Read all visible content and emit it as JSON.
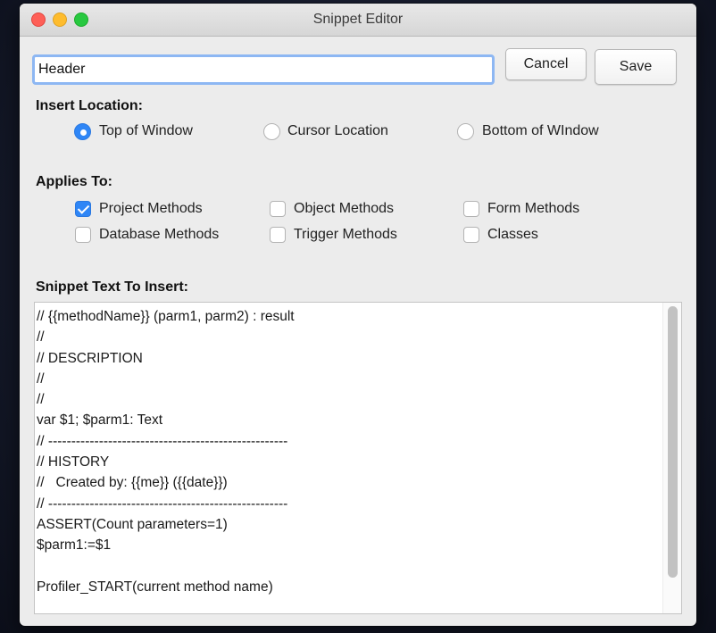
{
  "window": {
    "title": "Snippet Editor"
  },
  "name_field": {
    "value": "Header"
  },
  "buttons": {
    "cancel": "Cancel",
    "save": "Save"
  },
  "insert_location": {
    "label": "Insert Location:",
    "options": [
      {
        "label": "Top of Window",
        "selected": true
      },
      {
        "label": "Cursor Location",
        "selected": false
      },
      {
        "label": "Bottom of WIndow",
        "selected": false
      }
    ]
  },
  "applies_to": {
    "label": "Applies To:",
    "options": [
      {
        "label": "Project Methods",
        "checked": true
      },
      {
        "label": "Object Methods",
        "checked": false
      },
      {
        "label": "Form Methods",
        "checked": false
      },
      {
        "label": "Database Methods",
        "checked": false
      },
      {
        "label": "Trigger Methods",
        "checked": false
      },
      {
        "label": "Classes",
        "checked": false
      }
    ]
  },
  "snippet": {
    "label": "Snippet Text To Insert:",
    "text": "// {{methodName}} (parm1, parm2) : result\n//\n// DESCRIPTION\n//\n//\nvar $1; $parm1: Text\n// ----------------------------------------------------\n// HISTORY\n//   Created by: {{me}} ({{date}})\n// ----------------------------------------------------\nASSERT(Count parameters=1)\n$parm1:=$1\n\nProfiler_START(current method name)"
  }
}
